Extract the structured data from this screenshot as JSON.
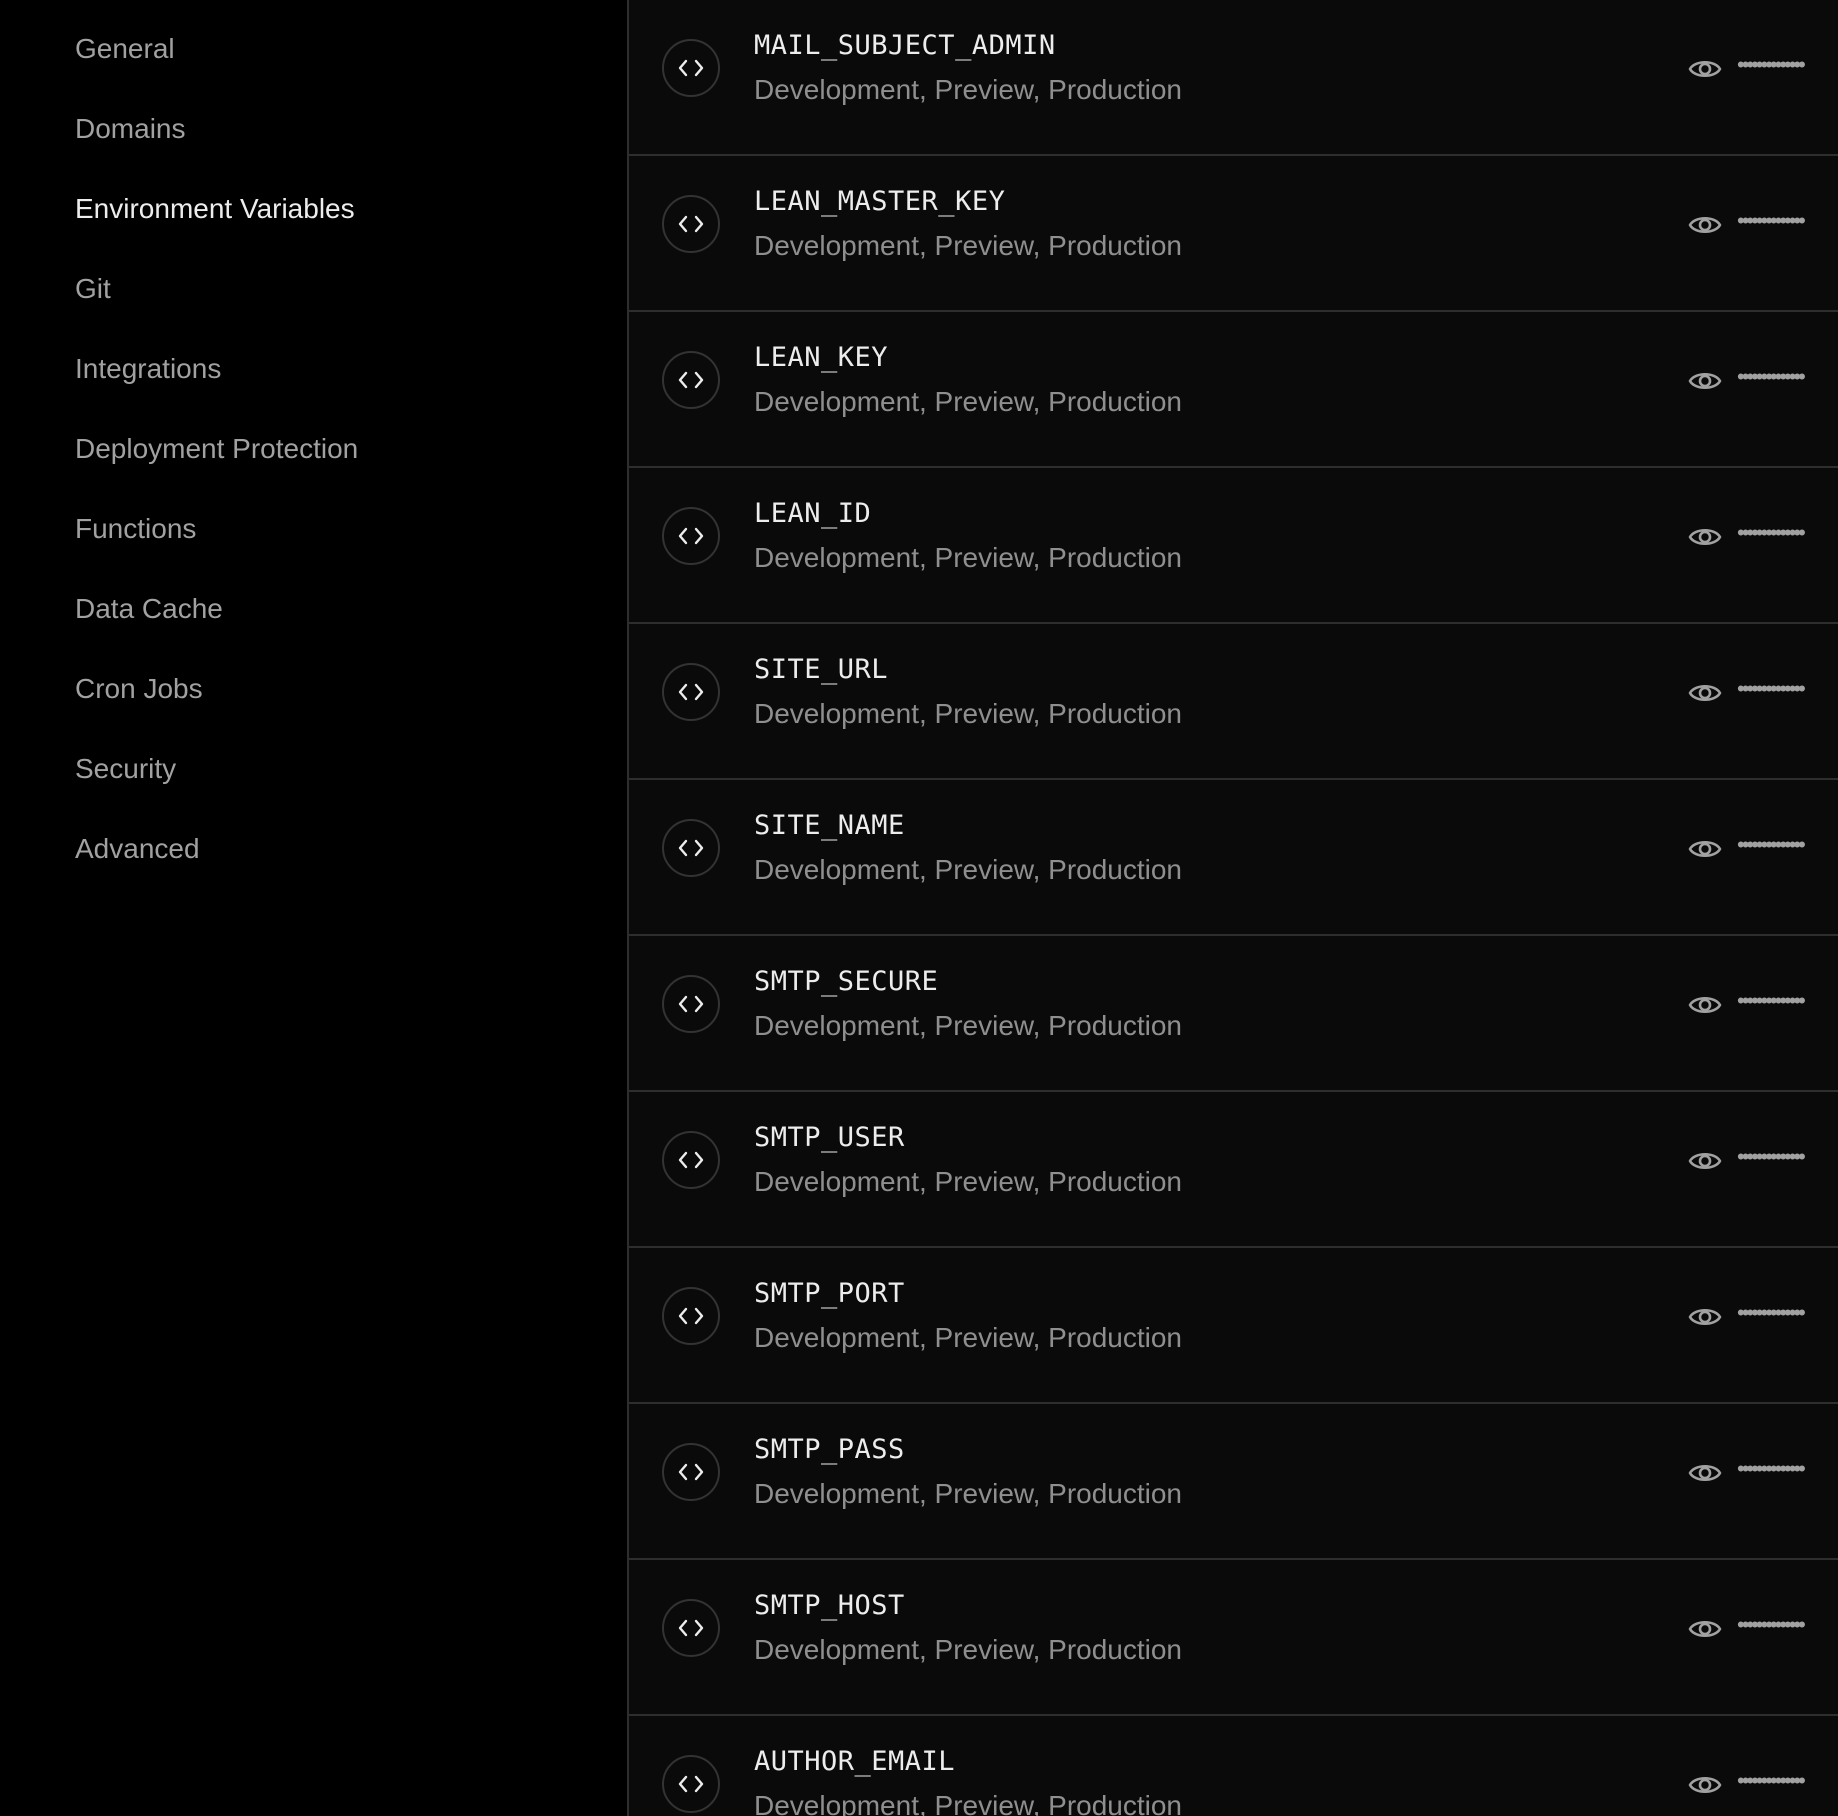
{
  "sidebar": {
    "items": [
      {
        "label": "General",
        "active": false
      },
      {
        "label": "Domains",
        "active": false
      },
      {
        "label": "Environment Variables",
        "active": true
      },
      {
        "label": "Git",
        "active": false
      },
      {
        "label": "Integrations",
        "active": false
      },
      {
        "label": "Deployment Protection",
        "active": false
      },
      {
        "label": "Functions",
        "active": false
      },
      {
        "label": "Data Cache",
        "active": false
      },
      {
        "label": "Cron Jobs",
        "active": false
      },
      {
        "label": "Security",
        "active": false
      },
      {
        "label": "Advanced",
        "active": false
      }
    ]
  },
  "env_vars": [
    {
      "name": "MAIL_SUBJECT_ADMIN",
      "environments": "Development, Preview, Production",
      "value_mask": "••••••••••••••",
      "icon": "code-icon",
      "reveal_icon": "eye-icon"
    },
    {
      "name": "LEAN_MASTER_KEY",
      "environments": "Development, Preview, Production",
      "value_mask": "••••••••••••••",
      "icon": "code-icon",
      "reveal_icon": "eye-icon"
    },
    {
      "name": "LEAN_KEY",
      "environments": "Development, Preview, Production",
      "value_mask": "••••••••••••••",
      "icon": "code-icon",
      "reveal_icon": "eye-icon"
    },
    {
      "name": "LEAN_ID",
      "environments": "Development, Preview, Production",
      "value_mask": "••••••••••••••",
      "icon": "code-icon",
      "reveal_icon": "eye-icon"
    },
    {
      "name": "SITE_URL",
      "environments": "Development, Preview, Production",
      "value_mask": "••••••••••••••",
      "icon": "code-icon",
      "reveal_icon": "eye-icon"
    },
    {
      "name": "SITE_NAME",
      "environments": "Development, Preview, Production",
      "value_mask": "••••••••••••••",
      "icon": "code-icon",
      "reveal_icon": "eye-icon"
    },
    {
      "name": "SMTP_SECURE",
      "environments": "Development, Preview, Production",
      "value_mask": "••••••••••••••",
      "icon": "code-icon",
      "reveal_icon": "eye-icon"
    },
    {
      "name": "SMTP_USER",
      "environments": "Development, Preview, Production",
      "value_mask": "••••••••••••••",
      "icon": "code-icon",
      "reveal_icon": "eye-icon"
    },
    {
      "name": "SMTP_PORT",
      "environments": "Development, Preview, Production",
      "value_mask": "••••••••••••••",
      "icon": "code-icon",
      "reveal_icon": "eye-icon"
    },
    {
      "name": "SMTP_PASS",
      "environments": "Development, Preview, Production",
      "value_mask": "••••••••••••••",
      "icon": "code-icon",
      "reveal_icon": "eye-icon"
    },
    {
      "name": "SMTP_HOST",
      "environments": "Development, Preview, Production",
      "value_mask": "••••••••••••••",
      "icon": "code-icon",
      "reveal_icon": "eye-icon"
    },
    {
      "name": "AUTHOR_EMAIL",
      "environments": "Development, Preview, Production",
      "value_mask": "••••••••••••••",
      "icon": "code-icon",
      "reveal_icon": "eye-icon"
    }
  ],
  "colors": {
    "sidebar_bg": "#000000",
    "main_bg": "#0a0a0a",
    "divider": "#2e2e2e",
    "text_primary": "#ededed",
    "text_secondary": "#8f8f8f",
    "text_muted": "#a1a1a1"
  }
}
